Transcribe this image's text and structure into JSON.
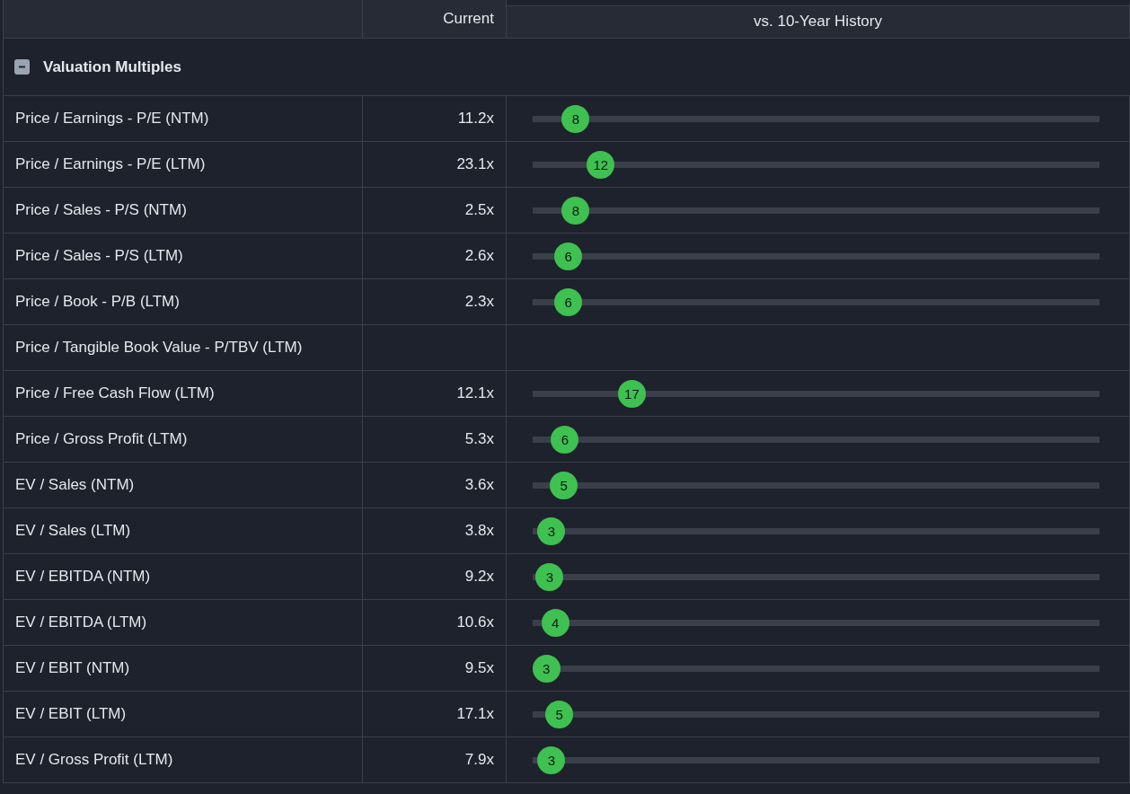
{
  "table": {
    "columns": [
      {},
      {
        "label": "Current"
      },
      {
        "label": "vs. 10-Year History"
      }
    ],
    "group": {
      "title": "Valuation Multiples",
      "expanded": true
    },
    "rows": [
      {
        "metric": "Price / Earnings - P/E (NTM)",
        "current": "11.2x",
        "level": 0.076,
        "rank": "8"
      },
      {
        "metric": "Price / Earnings - P/E (LTM)",
        "current": "23.1x",
        "level": 0.12,
        "rank": "12"
      },
      {
        "metric": "Price / Sales - P/S (NTM)",
        "current": "2.5x",
        "level": 0.076,
        "rank": "8"
      },
      {
        "metric": "Price / Sales - P/S (LTM)",
        "current": "2.6x",
        "level": 0.063,
        "rank": "6"
      },
      {
        "metric": "Price / Book - P/B (LTM)",
        "current": "2.3x",
        "level": 0.063,
        "rank": "6"
      },
      {
        "metric": "Price / Tangible Book Value - P/TBV (LTM)"
      },
      {
        "metric": "Price / Free Cash Flow (LTM)",
        "current": "12.1x",
        "level": 0.175,
        "rank": "17"
      },
      {
        "metric": "Price / Gross Profit (LTM)",
        "current": "5.3x",
        "level": 0.057,
        "rank": "6"
      },
      {
        "metric": "EV / Sales (NTM)",
        "current": "3.6x",
        "level": 0.055,
        "rank": "5"
      },
      {
        "metric": "EV / Sales (LTM)",
        "current": "3.8x",
        "level": 0.033,
        "rank": "3"
      },
      {
        "metric": "EV / EBITDA (NTM)",
        "current": "9.2x",
        "level": 0.03,
        "rank": "3"
      },
      {
        "metric": "EV / EBITDA (LTM)",
        "current": "10.6x",
        "level": 0.04,
        "rank": "4"
      },
      {
        "metric": "EV / EBIT (NTM)",
        "current": "9.5x",
        "level": 0.024,
        "rank": "3"
      },
      {
        "metric": "EV / EBIT (LTM)",
        "current": "17.1x",
        "level": 0.047,
        "rank": "5"
      },
      {
        "metric": "EV / Gross Profit (LTM)",
        "current": "7.9x",
        "level": 0.033,
        "rank": "3"
      }
    ]
  }
}
